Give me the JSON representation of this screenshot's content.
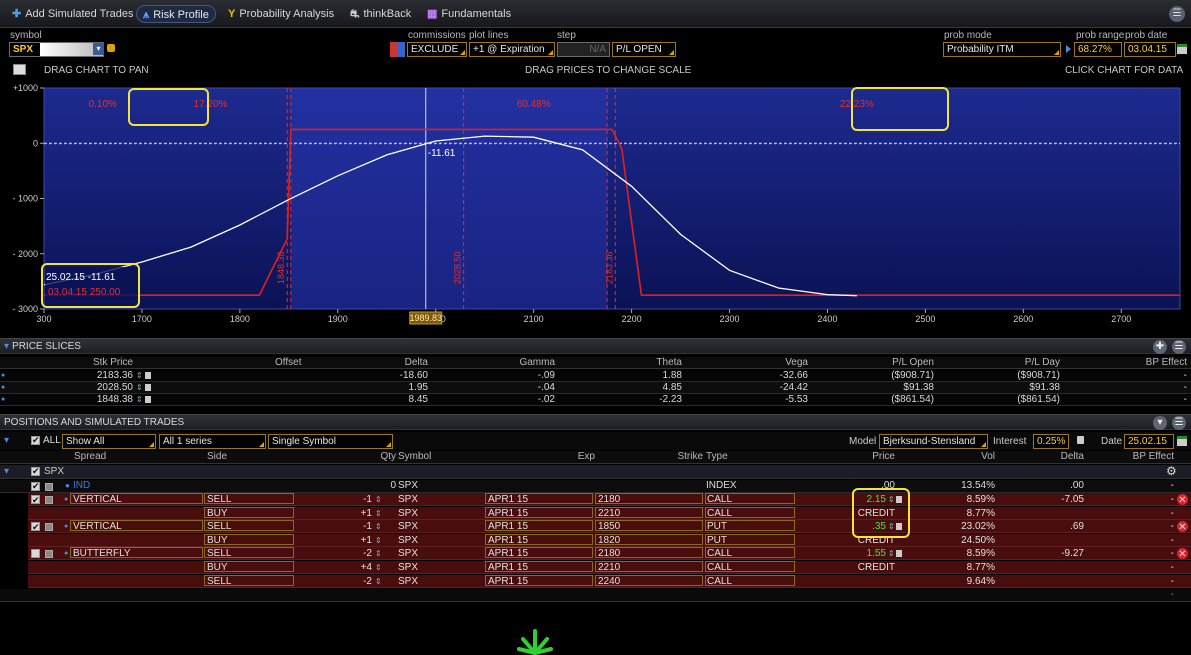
{
  "tabs": [
    {
      "label": "Add Simulated Trades",
      "icon": "plus-icon"
    },
    {
      "label": "Risk Profile",
      "icon": "risk-profile-icon",
      "active": true
    },
    {
      "label": "Probability Analysis",
      "icon": "probability-icon"
    },
    {
      "label": "thinkBack",
      "icon": "thinkback-icon"
    },
    {
      "label": "Fundamentals",
      "icon": "fundamentals-icon"
    }
  ],
  "controls": {
    "symbol_label": "symbol",
    "symbol_value": "SPX",
    "commissions_label": "commissions",
    "commissions_value": "EXCLUDE",
    "plot_lines_label": "plot lines",
    "plot_lines_value": "+1 @ Expiration",
    "step_label": "step",
    "step_value": "N/A",
    "pl_mode_value": "P/L OPEN",
    "prob_mode_label": "prob mode",
    "prob_mode_value": "Probability ITM",
    "prob_range_label": "prob range",
    "prob_range_value": "68.27%",
    "prob_date_label": "prob date",
    "prob_date_value": "03.04.15"
  },
  "chart_hints": {
    "left": "DRAG CHART TO PAN",
    "center": "DRAG PRICES TO CHANGE SCALE",
    "right": "CLICK CHART FOR DATA"
  },
  "chart_data": {
    "type": "line",
    "xlim": [
      1600,
      2760
    ],
    "ylim": [
      -3000,
      1000
    ],
    "x_ticks": [
      1600,
      1700,
      1800,
      1900,
      2000,
      2100,
      2200,
      2300,
      2400,
      2500,
      2600,
      2700
    ],
    "x_tick_labels": [
      "300",
      "1700",
      "1800",
      "1900",
      "2000",
      "2100",
      "2200",
      "2300",
      "2400",
      "2500",
      "2600",
      "2700"
    ],
    "y_ticks": [
      1000,
      0,
      -1000,
      -2000,
      -3000
    ],
    "y_tick_labels": [
      "+1000",
      "0",
      "- 1000",
      "- 2000",
      "- 3000"
    ],
    "current_price": 1989.83,
    "current_price_label": "1989.83",
    "zero_line": 0,
    "series": [
      {
        "style": "expiration",
        "color": "#e02020",
        "points": [
          [
            1600,
            -2750
          ],
          [
            1820,
            -2750
          ],
          [
            1848.38,
            -1730
          ],
          [
            1852,
            250
          ],
          [
            2180,
            250
          ],
          [
            2190,
            -100
          ],
          [
            2210,
            -2750
          ],
          [
            2760,
            -2750
          ]
        ]
      },
      {
        "style": "today",
        "color": "#ffffff",
        "points": [
          [
            1600,
            -2560
          ],
          [
            1650,
            -2380
          ],
          [
            1700,
            -2150
          ],
          [
            1750,
            -1880
          ],
          [
            1800,
            -1480
          ],
          [
            1850,
            -1020
          ],
          [
            1900,
            -590
          ],
          [
            1950,
            -210
          ],
          [
            2000,
            40
          ],
          [
            2050,
            130
          ],
          [
            2100,
            110
          ],
          [
            2150,
            -120
          ],
          [
            2200,
            -780
          ],
          [
            2250,
            -1650
          ],
          [
            2300,
            -2300
          ],
          [
            2350,
            -2620
          ],
          [
            2400,
            -2740
          ],
          [
            2430,
            -2760
          ]
        ]
      }
    ],
    "strike_lines": [
      {
        "x": 1848.38,
        "label": "1848.38"
      },
      {
        "x": 2028.5,
        "label": "2028.50"
      },
      {
        "x": 2183.36,
        "label": "2183.36"
      }
    ],
    "breakeven_lines": [
      1852,
      2175
    ],
    "probability_labels": [
      {
        "x": 1660,
        "text": "0.10%"
      },
      {
        "x": 1770,
        "text": "17.20%"
      },
      {
        "x": 2100,
        "text": "60.48%"
      },
      {
        "x": 2430,
        "text": "22.23%"
      }
    ],
    "marker_label": "-11.61",
    "tooltip_line1": "25.02.15 -11.61",
    "tooltip_line2": "03.04.15 250.00"
  },
  "price_slices": {
    "title": "PRICE SLICES",
    "columns": [
      "Stk Price",
      "Offset",
      "Delta",
      "Gamma",
      "Theta",
      "Vega",
      "P/L Open",
      "P/L Day",
      "BP Effect"
    ],
    "rows": [
      {
        "stk": "2183.36",
        "offset": "",
        "delta": "-18.60",
        "gamma": "-.09",
        "theta": "1.88",
        "vega": "-32.66",
        "pl_open": "($908.71)",
        "pl_day": "($908.71)",
        "bp": "-"
      },
      {
        "stk": "2028.50",
        "offset": "",
        "delta": "1.95",
        "gamma": "-.04",
        "theta": "4.85",
        "vega": "-24.42",
        "pl_open": "$91.38",
        "pl_day": "$91.38",
        "bp": "-"
      },
      {
        "stk": "1848.38",
        "offset": "",
        "delta": "8.45",
        "gamma": "-.02",
        "theta": "-2.23",
        "vega": "-5.53",
        "pl_open": "($861.54)",
        "pl_day": "($861.54)",
        "bp": "-"
      }
    ]
  },
  "positions": {
    "title": "POSITIONS AND SIMULATED TRADES",
    "all_label": "ALL",
    "filter1": "Show All",
    "filter2": "All 1 series",
    "filter3": "Single Symbol",
    "model_label": "Model",
    "model_value": "Bjerksund-Stensland",
    "interest_label": "Interest",
    "interest_value": "0.25%",
    "date_label": "Date",
    "date_value": "25.02.15",
    "columns": [
      "Spread",
      "Side",
      "Qty",
      "Symbol",
      "Exp",
      "Strike",
      "Type",
      "Price",
      "Vol",
      "Delta",
      "BP Effect"
    ],
    "group": "SPX",
    "ind_row": {
      "label": "IND",
      "qty": "0",
      "symbol": "SPX",
      "type": "INDEX",
      "price": ".00",
      "vol": "13.54%",
      "delta": ".00",
      "bp": "-"
    },
    "trades": [
      {
        "spread": "VERTICAL",
        "side": "SELL",
        "qty": "-1",
        "symbol": "SPX",
        "exp": "APR1 15",
        "strike": "2180",
        "type": "CALL",
        "price": "2.15",
        "vol": "8.59%",
        "delta": "-7.05",
        "bp": "-",
        "checked": true
      },
      {
        "spread": "",
        "side": "BUY",
        "qty": "+1",
        "symbol": "SPX",
        "exp": "APR1 15",
        "strike": "2210",
        "type": "CALL",
        "price": "CREDIT",
        "vol": "8.77%",
        "delta": "",
        "bp": "-"
      },
      {
        "spread": "VERTICAL",
        "side": "SELL",
        "qty": "-1",
        "symbol": "SPX",
        "exp": "APR1 15",
        "strike": "1850",
        "type": "PUT",
        "price": ".35",
        "vol": "23.02%",
        "delta": ".69",
        "bp": "-",
        "checked": true
      },
      {
        "spread": "",
        "side": "BUY",
        "qty": "+1",
        "symbol": "SPX",
        "exp": "APR1 15",
        "strike": "1820",
        "type": "PUT",
        "price": "CREDIT",
        "vol": "24.50%",
        "delta": "",
        "bp": "-"
      },
      {
        "spread": "BUTTERFLY",
        "side": "SELL",
        "qty": "-2",
        "symbol": "SPX",
        "exp": "APR1 15",
        "strike": "2180",
        "type": "CALL",
        "price": "1.55",
        "vol": "8.59%",
        "delta": "-9.27",
        "bp": "-",
        "checked": false
      },
      {
        "spread": "",
        "side": "BUY",
        "qty": "+4",
        "symbol": "SPX",
        "exp": "APR1 15",
        "strike": "2210",
        "type": "CALL",
        "price": "CREDIT",
        "vol": "8.77%",
        "delta": "",
        "bp": "-"
      },
      {
        "spread": "",
        "side": "SELL",
        "qty": "-2",
        "symbol": "SPX",
        "exp": "APR1 15",
        "strike": "2240",
        "type": "CALL",
        "price": "",
        "vol": "9.64%",
        "delta": "",
        "bp": "-"
      }
    ]
  }
}
